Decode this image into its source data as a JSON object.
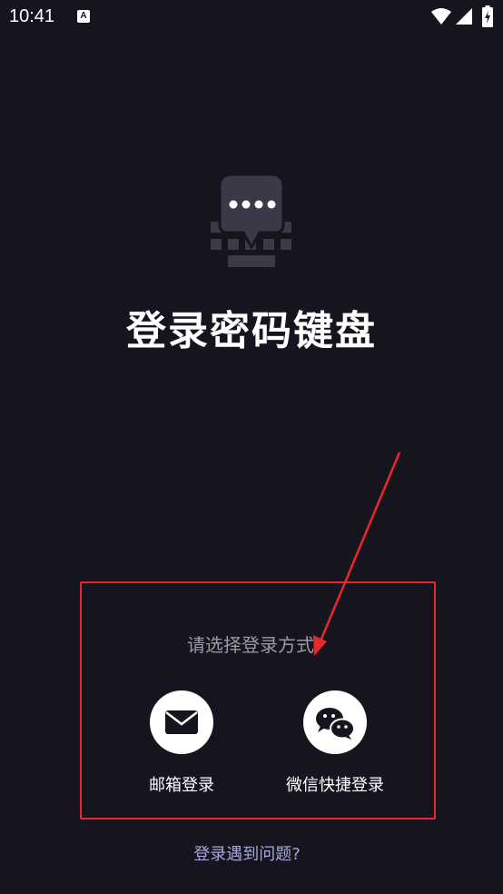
{
  "status_bar": {
    "time": "10:41",
    "notification_icon": "A"
  },
  "app": {
    "title": "登录密码键盘",
    "logo_icon": "keyboard-password-icon"
  },
  "login": {
    "prompt": "请选择登录方式",
    "options": [
      {
        "label": "邮箱登录",
        "icon": "mail-icon"
      },
      {
        "label": "微信快捷登录",
        "icon": "wechat-icon"
      }
    ],
    "help_link": "登录遇到问题?"
  },
  "colors": {
    "background": "#15141f",
    "highlight": "#e8282b",
    "link": "#a8a9d8"
  }
}
